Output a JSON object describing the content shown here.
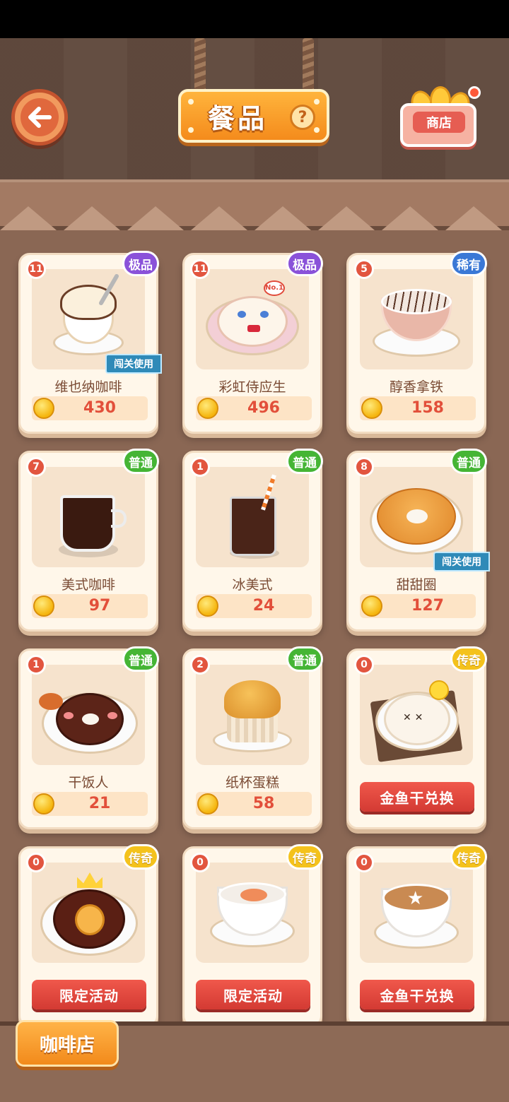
{
  "header": {
    "title": "餐品",
    "help_label": "?",
    "shop_label": "商店"
  },
  "footer": {
    "cafe_label": "咖啡店"
  },
  "items": [
    {
      "name": "维也纳咖啡",
      "count": "11",
      "rarity": "极品",
      "rarity_class": "epic",
      "price": "430",
      "tag": "闯关使用"
    },
    {
      "name": "彩虹侍应生",
      "count": "11",
      "rarity": "极品",
      "rarity_class": "epic",
      "price": "496"
    },
    {
      "name": "醇香拿铁",
      "count": "5",
      "rarity": "稀有",
      "rarity_class": "rare",
      "price": "158"
    },
    {
      "name": "美式咖啡",
      "count": "7",
      "rarity": "普通",
      "rarity_class": "common",
      "price": "97"
    },
    {
      "name": "冰美式",
      "count": "1",
      "rarity": "普通",
      "rarity_class": "common",
      "price": "24"
    },
    {
      "name": "甜甜圈",
      "count": "8",
      "rarity": "普通",
      "rarity_class": "common",
      "price": "127",
      "tag": "闯关使用"
    },
    {
      "name": "干饭人",
      "count": "1",
      "rarity": "普通",
      "rarity_class": "common",
      "price": "21"
    },
    {
      "name": "纸杯蛋糕",
      "count": "2",
      "rarity": "普通",
      "rarity_class": "common",
      "price": "58"
    },
    {
      "count": "0",
      "rarity": "传奇",
      "rarity_class": "legend",
      "action": "金鱼干兑换"
    },
    {
      "count": "0",
      "rarity": "传奇",
      "rarity_class": "legend",
      "action": "限定活动"
    },
    {
      "count": "0",
      "rarity": "传奇",
      "rarity_class": "legend",
      "action": "限定活动"
    },
    {
      "count": "0",
      "rarity": "传奇",
      "rarity_class": "legend",
      "action": "金鱼干兑换"
    }
  ],
  "colors": {
    "background": "#8a6754",
    "rarity_epic": "#8a52d9",
    "rarity_rare": "#3a78d6",
    "rarity_common": "#45b535",
    "rarity_legend": "#f4c21c",
    "price": "#e24f3a",
    "action_button": "#e04a40"
  }
}
